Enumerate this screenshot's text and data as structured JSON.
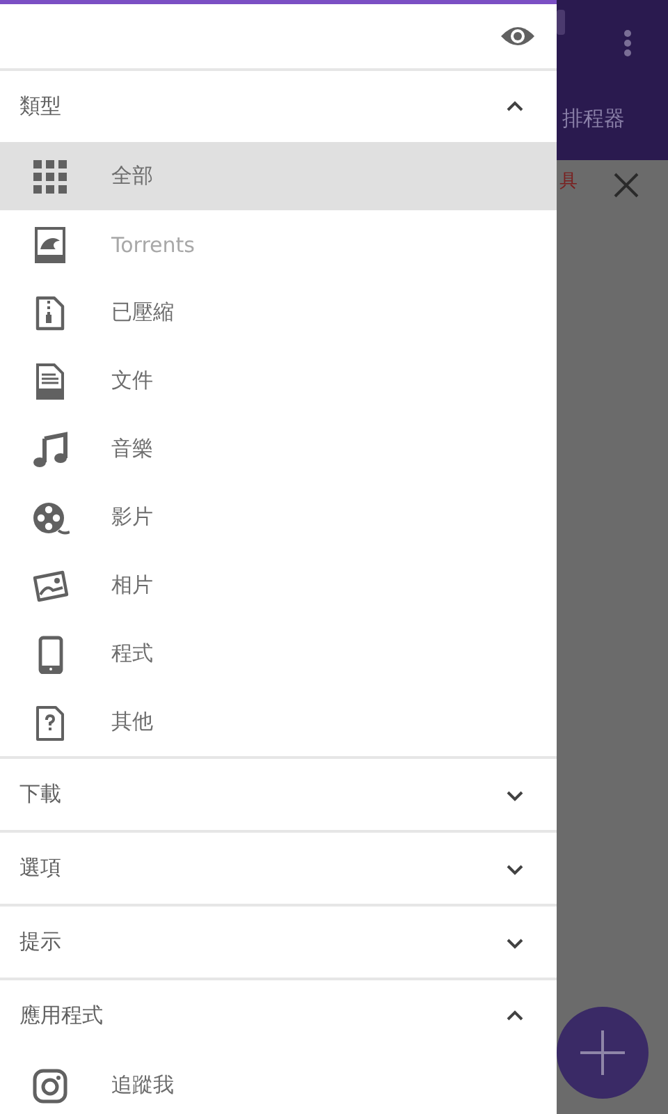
{
  "app_bar": {
    "tab": "排程器"
  },
  "banner": {
    "text": "具"
  },
  "drawer": {
    "sections": [
      {
        "title": "類型",
        "expanded": true,
        "items": [
          {
            "kind": "grid",
            "label": "全部",
            "selected": true,
            "disabled": false
          },
          {
            "kind": "torrent",
            "label": "Torrents",
            "selected": false,
            "disabled": true
          },
          {
            "kind": "zip",
            "label": "已壓縮",
            "selected": false,
            "disabled": false
          },
          {
            "kind": "doc",
            "label": "文件",
            "selected": false,
            "disabled": false
          },
          {
            "kind": "music",
            "label": "音樂",
            "selected": false,
            "disabled": false
          },
          {
            "kind": "film",
            "label": "影片",
            "selected": false,
            "disabled": false
          },
          {
            "kind": "photo",
            "label": "相片",
            "selected": false,
            "disabled": false
          },
          {
            "kind": "phone",
            "label": "程式",
            "selected": false,
            "disabled": false
          },
          {
            "kind": "unknown",
            "label": "其他",
            "selected": false,
            "disabled": false
          }
        ]
      },
      {
        "title": "下載",
        "expanded": false
      },
      {
        "title": "選項",
        "expanded": false
      },
      {
        "title": "提示",
        "expanded": false
      },
      {
        "title": "應用程式",
        "expanded": true,
        "items": [
          {
            "kind": "camera",
            "label": "追蹤我",
            "selected": false,
            "disabled": false
          }
        ]
      }
    ]
  }
}
